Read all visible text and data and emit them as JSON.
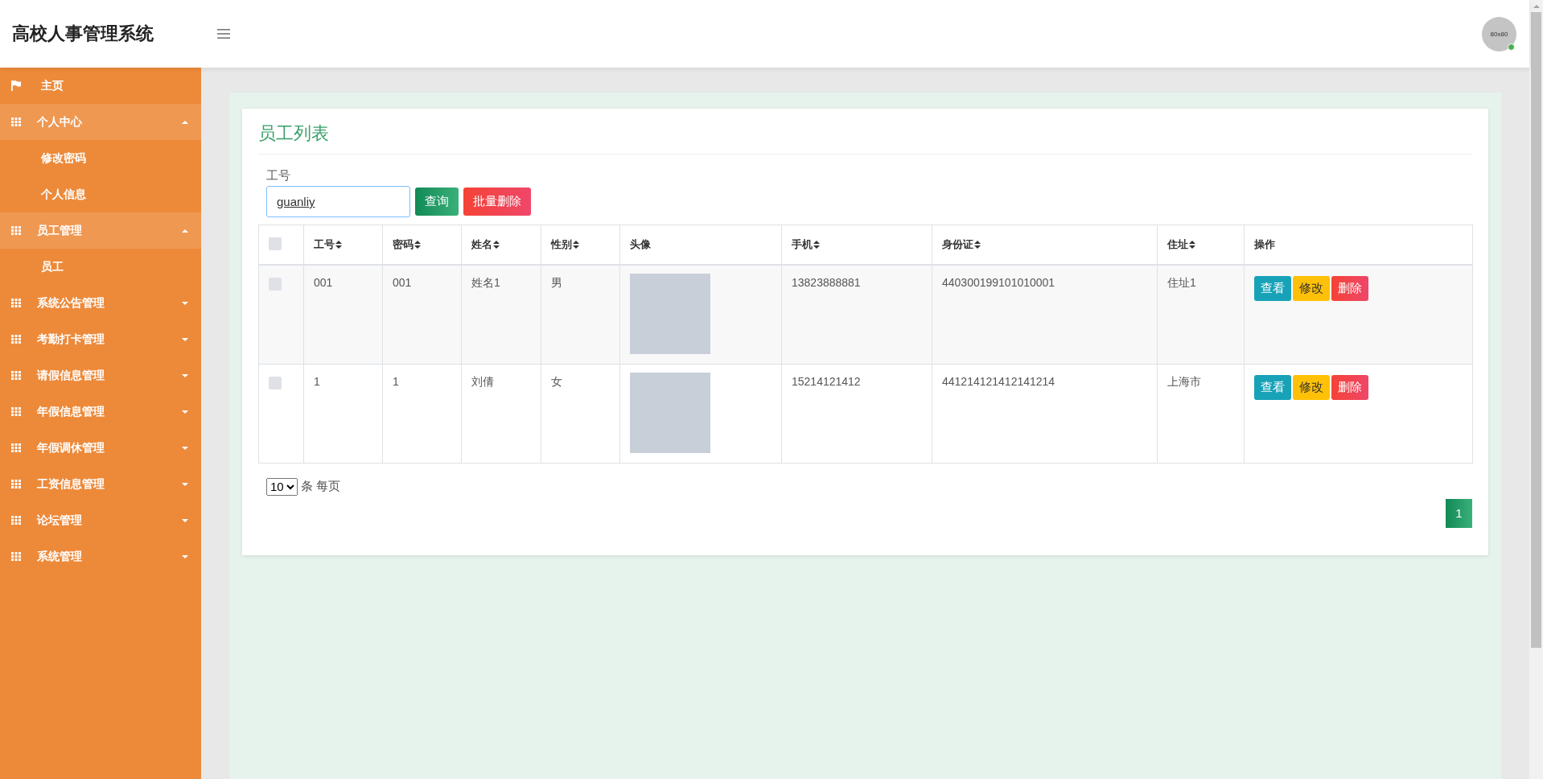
{
  "header": {
    "title": "高校人事管理系统",
    "avatar_text": "80x80"
  },
  "sidebar": {
    "items": [
      {
        "label": "主页",
        "kind": "link"
      },
      {
        "label": "个人中心",
        "kind": "menu",
        "expanded": true,
        "children": [
          {
            "label": "修改密码"
          },
          {
            "label": "个人信息"
          }
        ]
      },
      {
        "label": "员工管理",
        "kind": "menu",
        "expanded": true,
        "children": [
          {
            "label": "员工"
          }
        ]
      },
      {
        "label": "系统公告管理",
        "kind": "menu",
        "expanded": false
      },
      {
        "label": "考勤打卡管理",
        "kind": "menu",
        "expanded": false
      },
      {
        "label": "请假信息管理",
        "kind": "menu",
        "expanded": false
      },
      {
        "label": "年假信息管理",
        "kind": "menu",
        "expanded": false
      },
      {
        "label": "年假调休管理",
        "kind": "menu",
        "expanded": false
      },
      {
        "label": "工资信息管理",
        "kind": "menu",
        "expanded": false
      },
      {
        "label": "论坛管理",
        "kind": "menu",
        "expanded": false
      },
      {
        "label": "系统管理",
        "kind": "menu",
        "expanded": false
      }
    ]
  },
  "panel": {
    "title": "员工列表",
    "search": {
      "label": "工号",
      "value": "guanliy"
    },
    "buttons": [
      {
        "label": "查询",
        "kind": "search"
      },
      {
        "label": "批量删除",
        "kind": "delete"
      }
    ],
    "table": {
      "select_all": {
        "checked": false
      },
      "columns": [
        {
          "label": "工号",
          "sortable": true
        },
        {
          "label": "密码",
          "sortable": true
        },
        {
          "label": "姓名",
          "sortable": true
        },
        {
          "label": "性别",
          "sortable": true
        },
        {
          "label": "头像",
          "sortable": false
        },
        {
          "label": "手机",
          "sortable": true
        },
        {
          "label": "身份证",
          "sortable": true
        },
        {
          "label": "住址",
          "sortable": true
        },
        {
          "label": "操作",
          "sortable": false
        }
      ],
      "rows": [
        {
          "checked": false,
          "cells": [
            "001",
            "001",
            "姓名1",
            "男"
          ],
          "cells_after": [
            "13823888881",
            "440300199101010001",
            "住址1"
          ],
          "actions": [
            {
              "label": "查看",
              "kind": "view"
            },
            {
              "label": "修改",
              "kind": "edit"
            },
            {
              "label": "删除",
              "kind": "delete"
            }
          ]
        },
        {
          "checked": false,
          "cells": [
            "1",
            "1",
            "刘倩",
            "女"
          ],
          "cells_after": [
            "15214121412",
            "441214121412141214",
            "上海市"
          ],
          "actions": [
            {
              "label": "查看",
              "kind": "view"
            },
            {
              "label": "修改",
              "kind": "edit"
            },
            {
              "label": "删除",
              "kind": "delete"
            }
          ]
        }
      ]
    },
    "pagination": {
      "page_size": "10",
      "suffix": "条 每页",
      "pages": [
        {
          "label": "1",
          "selected": true
        }
      ]
    }
  }
}
